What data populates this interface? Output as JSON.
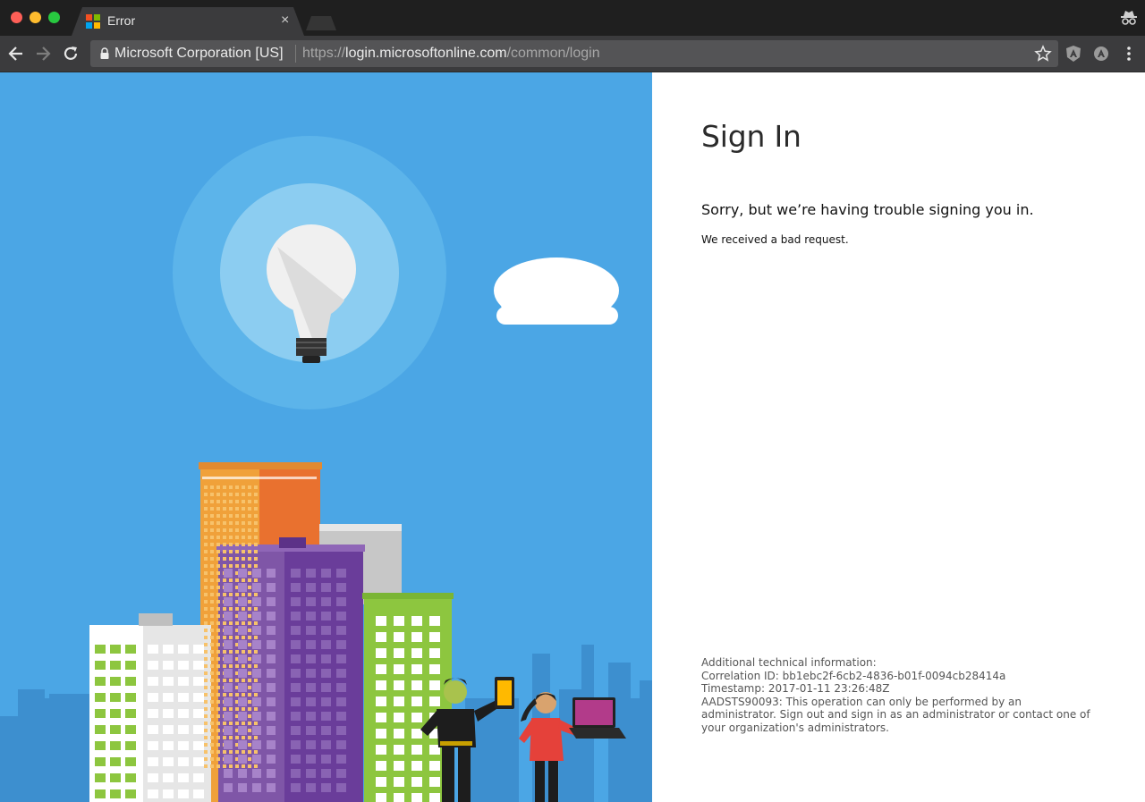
{
  "browser": {
    "tab": {
      "title": "Error",
      "close": "×"
    },
    "security_label": "Microsoft Corporation [US]",
    "url": {
      "scheme": "https://",
      "host": "login.microsoftonline.com",
      "path": "/common/login"
    }
  },
  "icons": {
    "favicon": "microsoft-logo-icon",
    "incognito": "incognito-icon",
    "back": "back-arrow-icon",
    "forward": "forward-arrow-icon",
    "reload": "reload-icon",
    "lock": "lock-icon",
    "bookmark": "star-icon",
    "extension_1": "angular-shield-icon",
    "extension_2": "angular-circle-icon",
    "menu": "kebab-menu-icon"
  },
  "colors": {
    "illustration_bg": "#4ba6e5",
    "ms_red": "#f25022",
    "ms_green": "#7fba00",
    "ms_blue": "#00a4ef",
    "ms_yellow": "#ffb900"
  },
  "page": {
    "title": "Sign In",
    "error_heading": "Sorry, but we’re having trouble signing you in.",
    "error_detail": "We received a bad request.",
    "tech_info": {
      "label": "Additional technical information:",
      "correlation": "Correlation ID: bb1ebc2f-6cb2-4836-b01f-0094cb28414a",
      "timestamp": "Timestamp: 2017-01-11 23:26:48Z",
      "message": "AADSTS90093: This operation can only be performed by an administrator. Sign out and sign in as an administrator or contact one of your organization's administrators."
    }
  }
}
